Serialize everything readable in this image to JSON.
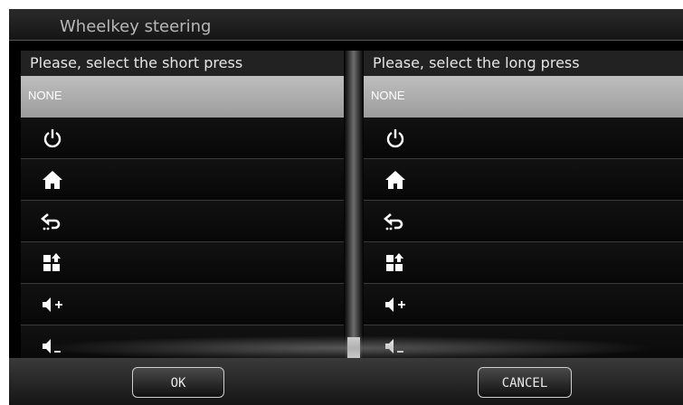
{
  "title": "Wheelkey steering",
  "short_panel": {
    "header": "Please, select the short press",
    "items": [
      {
        "label": "NONE",
        "icon": "",
        "selected": true
      },
      {
        "label": "",
        "icon": "power-icon",
        "selected": false
      },
      {
        "label": "",
        "icon": "home-icon",
        "selected": false
      },
      {
        "label": "",
        "icon": "back-icon",
        "selected": false
      },
      {
        "label": "",
        "icon": "apps-icon",
        "selected": false
      },
      {
        "label": "",
        "icon": "volume-up-icon",
        "selected": false
      },
      {
        "label": "",
        "icon": "volume-down-icon",
        "selected": false
      }
    ]
  },
  "long_panel": {
    "header": "Please, select the long press",
    "items": [
      {
        "label": "NONE",
        "icon": "",
        "selected": true
      },
      {
        "label": "",
        "icon": "power-icon",
        "selected": false
      },
      {
        "label": "",
        "icon": "home-icon",
        "selected": false
      },
      {
        "label": "",
        "icon": "back-icon",
        "selected": false
      },
      {
        "label": "",
        "icon": "apps-icon",
        "selected": false
      },
      {
        "label": "",
        "icon": "volume-up-icon",
        "selected": false
      },
      {
        "label": "",
        "icon": "volume-down-icon",
        "selected": false
      }
    ]
  },
  "buttons": {
    "ok": "OK",
    "cancel": "CANCEL"
  },
  "colors": {
    "selected_row": "#aeaeae",
    "background": "#000000",
    "text": "#ffffff"
  }
}
